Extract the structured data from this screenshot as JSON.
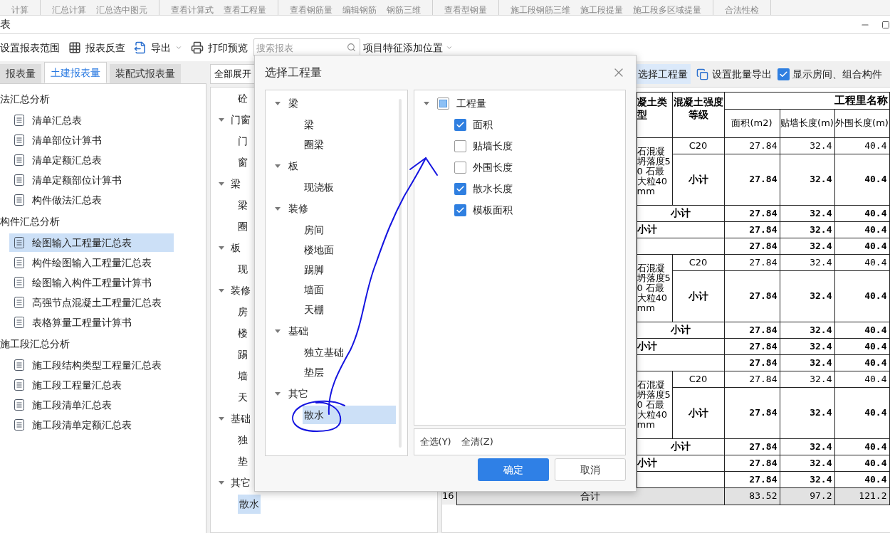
{
  "top_strip": [
    [
      "计算"
    ],
    [
      "汇总计算",
      "汇总选中图元"
    ],
    [
      "查看计算式",
      "查看工程量"
    ],
    [
      "查看钢筋量",
      "编辑钢筋",
      "钢筋三维"
    ],
    [
      "查看型钢量"
    ],
    [
      "施工段钢筋三维",
      "施工段提量",
      "施工段多区域提量"
    ],
    [
      "合法性检"
    ]
  ],
  "window": {
    "title": "表"
  },
  "toolbar": {
    "range": "设置报表范围",
    "reverse": "报表反查",
    "export": "导出",
    "preview": "打印预览",
    "search_placeholder": "搜索报表",
    "feature_position": "项目特征添加位置"
  },
  "left_tabs": [
    {
      "label": "报表量",
      "selected": false
    },
    {
      "label": "土建报表量",
      "selected": true
    },
    {
      "label": "装配式报表量",
      "selected": false
    }
  ],
  "report_tree": [
    {
      "label": "法汇总分析",
      "children": [
        {
          "label": "清单汇总表",
          "selected": false
        },
        {
          "label": "清单部位计算书",
          "selected": false
        },
        {
          "label": "清单定额汇总表",
          "selected": false
        },
        {
          "label": "清单定额部位计算书",
          "selected": false
        },
        {
          "label": "构件做法汇总表",
          "selected": false
        }
      ]
    },
    {
      "label": "构件汇总分析",
      "children": [
        {
          "label": "绘图输入工程量汇总表",
          "selected": true
        },
        {
          "label": "构件绘图输入工程量汇总表",
          "selected": false
        },
        {
          "label": "绘图输入构件工程量计算书",
          "selected": false
        },
        {
          "label": "高强节点混凝土工程量汇总表",
          "selected": false
        },
        {
          "label": "表格算量工程量计算书",
          "selected": false
        }
      ]
    },
    {
      "label": "施工段汇总分析",
      "children": [
        {
          "label": "施工段结构类型工程量汇总表",
          "selected": false
        },
        {
          "label": "施工段工程量汇总表",
          "selected": false
        },
        {
          "label": "施工段清单汇总表",
          "selected": false
        },
        {
          "label": "施工段清单定额汇总表",
          "selected": false
        }
      ]
    }
  ],
  "middle": {
    "expand_all": "全部展开",
    "leading_item": {
      "label": "砼",
      "selected": false
    },
    "groups": [
      {
        "label": "门窗",
        "expanded": true,
        "children": [
          {
            "label": "门",
            "selected": false
          },
          {
            "label": "窗",
            "selected": false
          }
        ]
      },
      {
        "label": "梁",
        "expanded": true,
        "children": [
          {
            "label": "梁",
            "selected": false
          },
          {
            "label": "圈",
            "selected": false
          }
        ]
      },
      {
        "label": "板",
        "expanded": true,
        "children": [
          {
            "label": "现",
            "selected": false
          }
        ]
      },
      {
        "label": "装修",
        "expanded": true,
        "children": [
          {
            "label": "房",
            "selected": false
          },
          {
            "label": "楼",
            "selected": false
          },
          {
            "label": "踢",
            "selected": false
          },
          {
            "label": "墙",
            "selected": false
          },
          {
            "label": "天",
            "selected": false
          }
        ]
      },
      {
        "label": "基础",
        "expanded": true,
        "children": [
          {
            "label": "独",
            "selected": false
          },
          {
            "label": "垫",
            "selected": false
          }
        ]
      },
      {
        "label": "其它",
        "expanded": true,
        "children": [
          {
            "label": "散水",
            "selected": true
          }
        ]
      }
    ]
  },
  "right_toolbar": {
    "select_quantity": "选择工程量",
    "batch_export": "设置批量导出",
    "show_rooms": {
      "label": "显示房间、组合构件",
      "checked": true
    }
  },
  "report_table": {
    "desc_header": "凝土类型",
    "grade_header": "混凝土强度等级",
    "group_header": "工程里名称",
    "columns": [
      "面积(m2)",
      "贴墙长度(m)",
      "外围长度(m)"
    ],
    "rows": [
      {
        "kind": "item",
        "description": "石混凝坍落度50 石最大粒40mm",
        "grade": "C20",
        "values": [
          "27.84",
          "32.4",
          "40.4"
        ]
      },
      {
        "kind": "subtotal",
        "label": "小计",
        "values": [
          "27.84",
          "32.4",
          "40.4"
        ]
      },
      {
        "kind": "group_subtotal",
        "label": "小计",
        "values": [
          "27.84",
          "32.4",
          "40.4"
        ]
      },
      {
        "kind": "category_subtotal",
        "label": "小计",
        "values": [
          "27.84",
          "32.4",
          "40.4"
        ]
      },
      {
        "kind": "blank_total",
        "values": [
          "27.84",
          "32.4",
          "40.4"
        ]
      },
      {
        "kind": "item",
        "description": "石混凝坍落度50 石最大粒40mm",
        "grade": "C20",
        "values": [
          "27.84",
          "32.4",
          "40.4"
        ]
      },
      {
        "kind": "subtotal",
        "label": "小计",
        "values": [
          "27.84",
          "32.4",
          "40.4"
        ]
      },
      {
        "kind": "group_subtotal",
        "label": "小计",
        "values": [
          "27.84",
          "32.4",
          "40.4"
        ]
      },
      {
        "kind": "category_subtotal",
        "label": "小计",
        "values": [
          "27.84",
          "32.4",
          "40.4"
        ]
      },
      {
        "kind": "blank_total",
        "values": [
          "27.84",
          "32.4",
          "40.4"
        ]
      },
      {
        "kind": "item",
        "description": "石混凝坍落度50 石最大粒40mm",
        "grade": "C20",
        "values": [
          "27.84",
          "32.4",
          "40.4"
        ]
      },
      {
        "kind": "subtotal",
        "label": "小计",
        "values": [
          "27.84",
          "32.4",
          "40.4"
        ]
      },
      {
        "kind": "group_subtotal",
        "label": "小计",
        "values": [
          "27.84",
          "32.4",
          "40.4"
        ]
      },
      {
        "kind": "category_subtotal",
        "label": "小计",
        "values": [
          "27.84",
          "32.4",
          "40.4"
        ]
      },
      {
        "kind": "blank_total",
        "values": [
          "27.84",
          "32.4",
          "40.4"
        ]
      },
      {
        "kind": "total",
        "row_number": "16",
        "label": "合计",
        "values": [
          "83.52",
          "97.2",
          "121.2"
        ]
      }
    ]
  },
  "dialog": {
    "title": "选择工程量",
    "tree": [
      {
        "label": "梁",
        "expanded": true,
        "children": [
          {
            "label": "梁",
            "selected": false
          },
          {
            "label": "圈梁",
            "selected": false
          }
        ]
      },
      {
        "label": "板",
        "expanded": true,
        "children": [
          {
            "label": "现浇板",
            "selected": false
          }
        ]
      },
      {
        "label": "装修",
        "expanded": true,
        "children": [
          {
            "label": "房间",
            "selected": false
          },
          {
            "label": "楼地面",
            "selected": false
          },
          {
            "label": "踢脚",
            "selected": false
          },
          {
            "label": "墙面",
            "selected": false
          },
          {
            "label": "天棚",
            "selected": false
          }
        ]
      },
      {
        "label": "基础",
        "expanded": true,
        "children": [
          {
            "label": "独立基础",
            "selected": false
          },
          {
            "label": "垫层",
            "selected": false
          }
        ]
      },
      {
        "label": "其它",
        "expanded": true,
        "children": [
          {
            "label": "散水",
            "selected": true
          }
        ]
      }
    ],
    "quantities": {
      "label": "工程量",
      "expanded": true,
      "indeterminate": true,
      "children": [
        {
          "label": "面积",
          "checked": true
        },
        {
          "label": "贴墙长度",
          "checked": false
        },
        {
          "label": "外围长度",
          "checked": false
        },
        {
          "label": "散水长度",
          "checked": true
        },
        {
          "label": "模板面积",
          "checked": true
        }
      ]
    },
    "select_all": "全选(Y)",
    "clear_all": "全清(Z)",
    "ok": "确定",
    "cancel": "取消"
  }
}
